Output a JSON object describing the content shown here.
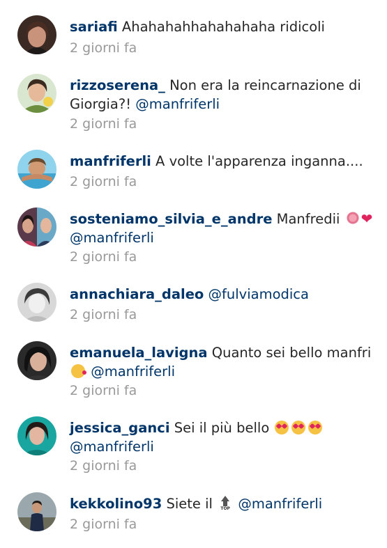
{
  "comments": [
    {
      "username": "sariafi",
      "text": "Ahahahahhahahahaha ridicoli",
      "time": "2 giorni fa"
    },
    {
      "username": "rizzoserena_",
      "text": "Non era la reincarnazione di Giorgia?!",
      "mention": "@manfriferli",
      "time": "2 giorni fa"
    },
    {
      "username": "manfriferli",
      "text": "A volte l'apparenza inganna....",
      "time": "2 giorni fa"
    },
    {
      "username": "sosteniamo_silvia_e_andre",
      "text": "Manfredii",
      "mention": "@manfriferli",
      "time": "2 giorni fa"
    },
    {
      "username": "annachiara_daleo",
      "mention": "@fulviamodica",
      "time": "2 giorni fa"
    },
    {
      "username": "emanuela_lavigna",
      "text": "Quanto sei bello manfri",
      "mention": "@manfriferli",
      "time": "2 giorni fa"
    },
    {
      "username": "jessica_ganci",
      "text": "Sei il più bello",
      "mention": "@manfriferli",
      "time": "2 giorni fa"
    },
    {
      "username": "kekkolino93",
      "text": "Siete il",
      "mention": "@manfriferli",
      "time": "2 giorni fa"
    }
  ],
  "emojis": {
    "rose": "rose-emoji",
    "heart": "red-heart-emoji",
    "kiss": "face-blowing-kiss-emoji",
    "love": "heart-eyes-emoji",
    "top": "top-arrow-emoji",
    "top_label": "TOP"
  },
  "colors": {
    "username": "#003569",
    "mention": "#003569",
    "text": "#262626",
    "timestamp": "#999999"
  }
}
